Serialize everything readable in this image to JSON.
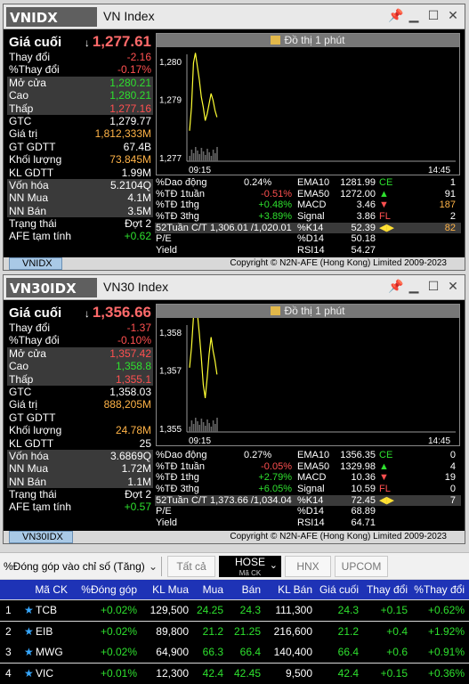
{
  "windows": [
    {
      "code": "VNIDX",
      "name": "VN Index",
      "price_label": "Giá cuối",
      "price_arrow": "↓",
      "price": "1,277.61",
      "rows": [
        {
          "label": "Thay đổi",
          "value": "-2.16",
          "color": "#ff5050"
        },
        {
          "label": "%Thay đổi",
          "value": "-0.17%",
          "color": "#ff5050"
        },
        {
          "label": "Mở cửa",
          "value": "1,280.21",
          "color": "#2ee02e"
        },
        {
          "label": "Cao",
          "value": "1,280.21",
          "color": "#2ee02e"
        },
        {
          "label": "Thấp",
          "value": "1,277.16",
          "color": "#ff5050"
        },
        {
          "label": "GTC",
          "value": "1,279.77",
          "color": "#ffffff"
        },
        {
          "label": "Giá trị",
          "value": "1,812,333M",
          "color": "#ffb347"
        },
        {
          "label": "GT GDTT",
          "value": "67.4B",
          "color": "#ffffff"
        },
        {
          "label": "Khối lượng",
          "value": "73.845M",
          "color": "#ffb347"
        },
        {
          "label": "KL GDTT",
          "value": "1.99M",
          "color": "#ffffff"
        },
        {
          "label": "Vốn hóa",
          "value": "5.2104Q",
          "color": "#ffffff"
        },
        {
          "label": "NN Mua",
          "value": "4.1M",
          "color": "#ffffff"
        },
        {
          "label": "NN Bán",
          "value": "3.5M",
          "color": "#ffffff"
        },
        {
          "label": "Trạng thái",
          "value": "Đợt 2",
          "color": "#ffffff"
        },
        {
          "label": "AFE tạm tính",
          "value": "+0.62",
          "color": "#2ee02e"
        }
      ],
      "chart_title": "Đồ thị 1 phút",
      "chart_data": {
        "type": "line",
        "y_ticks": [
          "1,280",
          "1,279",
          "1,277"
        ],
        "ylim": [
          1277,
          1280
        ],
        "x_ticks": [
          "09:15",
          "14:45"
        ],
        "series": [
          {
            "values": [
              1277.9,
              1278.6,
              1279.9,
              1280.2,
              1279.8,
              1279.4,
              1278.9,
              1278.6,
              1278.2,
              1278.4,
              1278.7,
              1279.0,
              1278.8,
              1278.5,
              1278.3
            ]
          }
        ]
      },
      "stats": {
        "dao_dong_label": "%Dao động",
        "dao_dong": "0.24%",
        "td_1tuan_label": "%TĐ 1tuần",
        "td_1tuan": "-0.51%",
        "td_1thg_label": "%TĐ 1thg",
        "td_1thg": "+0.48%",
        "td_3thg_label": "%TĐ 3thg",
        "td_3thg": "+3.89%",
        "ema10_label": "EMA10",
        "ema10": "1281.99",
        "ema50_label": "EMA50",
        "ema50": "1272.00",
        "macd_label": "MACD",
        "macd": "3.46",
        "signal_label": "Signal",
        "signal": "3.86",
        "ce_label": "CE",
        "ce": "1",
        "ema50_right": "91",
        "macd_right": "187",
        "fl_label": "FL",
        "fl": "2",
        "w52_label": "52Tuần C/T",
        "w52": "1,306.01 /1,020.01",
        "k14_label": "%K14",
        "k14": "52.39",
        "k14_right": "82",
        "pe_label": "P/E",
        "d14_label": "%D14",
        "d14": "50.18",
        "yield_label": "Yield",
        "rsi_label": "RSI14",
        "rsi": "54.27"
      },
      "footer_tab": "VNIDX",
      "copyright": "Copyright © N2N-AFE (Hong Kong) Limited 2009-2023"
    },
    {
      "code": "VN30IDX",
      "name": "VN30 Index",
      "price_label": "Giá cuối",
      "price_arrow": "↓",
      "price": "1,356.66",
      "rows": [
        {
          "label": "Thay đổi",
          "value": "-1.37",
          "color": "#ff5050"
        },
        {
          "label": "%Thay đổi",
          "value": "-0.10%",
          "color": "#ff5050"
        },
        {
          "label": "Mở cửa",
          "value": "1,357.42",
          "color": "#ff5050"
        },
        {
          "label": "Cao",
          "value": "1,358.8",
          "color": "#2ee02e"
        },
        {
          "label": "Thấp",
          "value": "1,355.1",
          "color": "#ff5050"
        },
        {
          "label": "GTC",
          "value": "1,358.03",
          "color": "#ffffff"
        },
        {
          "label": "Giá trị",
          "value": "888,205M",
          "color": "#ffb347"
        },
        {
          "label": "GT GDTT",
          "value": "",
          "color": "#ffffff"
        },
        {
          "label": "Khối lượng",
          "value": "24.78M",
          "color": "#ffb347"
        },
        {
          "label": "KL GDTT",
          "value": "25",
          "color": "#ffffff"
        },
        {
          "label": "Vốn hóa",
          "value": "3.6869Q",
          "color": "#ffffff"
        },
        {
          "label": "NN Mua",
          "value": "1.72M",
          "color": "#ffffff"
        },
        {
          "label": "NN Bán",
          "value": "1.1M",
          "color": "#ffffff"
        },
        {
          "label": "Trạng thái",
          "value": "Đợt 2",
          "color": "#ffffff"
        },
        {
          "label": "AFE tạm tính",
          "value": "+0.57",
          "color": "#2ee02e"
        }
      ],
      "chart_title": "Đồ thị 1 phút",
      "chart_data": {
        "type": "line",
        "y_ticks": [
          "1,358",
          "1,357",
          "1,355"
        ],
        "ylim": [
          1355,
          1358
        ],
        "x_ticks": [
          "09:15",
          "14:45"
        ],
        "series": [
          {
            "values": [
              1356.9,
              1357.5,
              1358.4,
              1358.8,
              1358.5,
              1357.9,
              1357.2,
              1356.4,
              1356.0,
              1356.6,
              1357.3,
              1357.8,
              1357.4,
              1357.1,
              1356.7
            ]
          }
        ]
      },
      "stats": {
        "dao_dong_label": "%Dao động",
        "dao_dong": "0.27%",
        "td_1tuan_label": "%TĐ 1tuần",
        "td_1tuan": "-0.05%",
        "td_1thg_label": "%TĐ 1thg",
        "td_1thg": "+2.79%",
        "td_3thg_label": "%TĐ 3thg",
        "td_3thg": "+6.05%",
        "ema10_label": "EMA10",
        "ema10": "1356.35",
        "ema50_label": "EMA50",
        "ema50": "1329.98",
        "macd_label": "MACD",
        "macd": "10.36",
        "signal_label": "Signal",
        "signal": "10.59",
        "ce_label": "CE",
        "ce": "0",
        "ema50_right": "4",
        "macd_right": "19",
        "fl_label": "FL",
        "fl": "0",
        "w52_label": "52Tuần C/T",
        "w52": "1,373.66 /1,034.04",
        "k14_label": "%K14",
        "k14": "72.45",
        "k14_right": "7",
        "pe_label": "P/E",
        "d14_label": "%D14",
        "d14": "68.89",
        "yield_label": "Yield",
        "rsi_label": "RSI14",
        "rsi": "64.71"
      },
      "footer_tab": "VN30IDX",
      "copyright": "Copyright © N2N-AFE (Hong Kong) Limited 2009-2023"
    }
  ],
  "toolbar": {
    "dropdown": "%Đóng góp vào chỉ số (Tăng)",
    "btn_all": "Tất cả",
    "btn_hose": "HOSE",
    "btn_hose_sub": "Mã CK",
    "btn_hnx": "HNX",
    "btn_upcom": "UPCOM"
  },
  "table": {
    "headers": [
      "Mã CK",
      "%Đóng góp",
      "KL Mua",
      "Mua",
      "Bán",
      "KL Bán",
      "Giá cuối",
      "Thay đổi",
      "%Thay đổi"
    ],
    "rows": [
      {
        "no": "1",
        "code": "TCB",
        "contrib": "+0.02%",
        "kl_mua": "129,500",
        "mua": "24.25",
        "ban": "24.3",
        "kl_ban": "111,300",
        "gia": "24.3",
        "td": "+0.15",
        "pct": "+0.62%"
      },
      {
        "no": "2",
        "code": "EIB",
        "contrib": "+0.02%",
        "kl_mua": "89,800",
        "mua": "21.2",
        "ban": "21.25",
        "kl_ban": "216,600",
        "gia": "21.2",
        "td": "+0.4",
        "pct": "+1.92%"
      },
      {
        "no": "3",
        "code": "MWG",
        "contrib": "+0.02%",
        "kl_mua": "64,900",
        "mua": "66.3",
        "ban": "66.4",
        "kl_ban": "140,400",
        "gia": "66.4",
        "td": "+0.6",
        "pct": "+0.91%"
      },
      {
        "no": "4",
        "code": "VIC",
        "contrib": "+0.01%",
        "kl_mua": "12,300",
        "mua": "42.4",
        "ban": "42.45",
        "kl_ban": "9,500",
        "gia": "42.4",
        "td": "+0.15",
        "pct": "+0.36%"
      }
    ]
  },
  "colors": {
    "up": "#2ee02e",
    "down": "#ff5050",
    "volume": "#ffb347",
    "header_bg": "#1e33b6",
    "line": "#ffff33"
  }
}
